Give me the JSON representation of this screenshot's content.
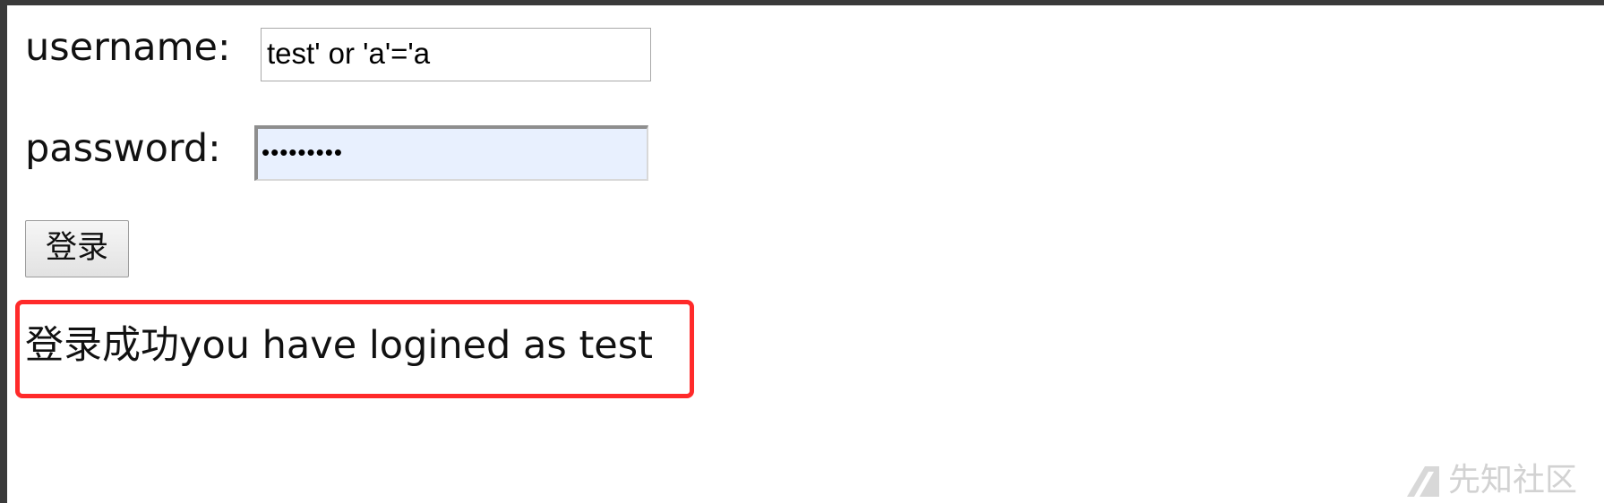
{
  "form": {
    "username_label": "username:",
    "username_value": "test' or 'a'='a",
    "password_label": "password:",
    "password_value": "•••••••••",
    "login_button": "登录"
  },
  "result": {
    "message": "登录成功you have logined as test",
    "highlight_color": "#ff2a2a"
  },
  "watermark": {
    "icon": "xianzhi-logo-icon",
    "text": "先知社区"
  }
}
